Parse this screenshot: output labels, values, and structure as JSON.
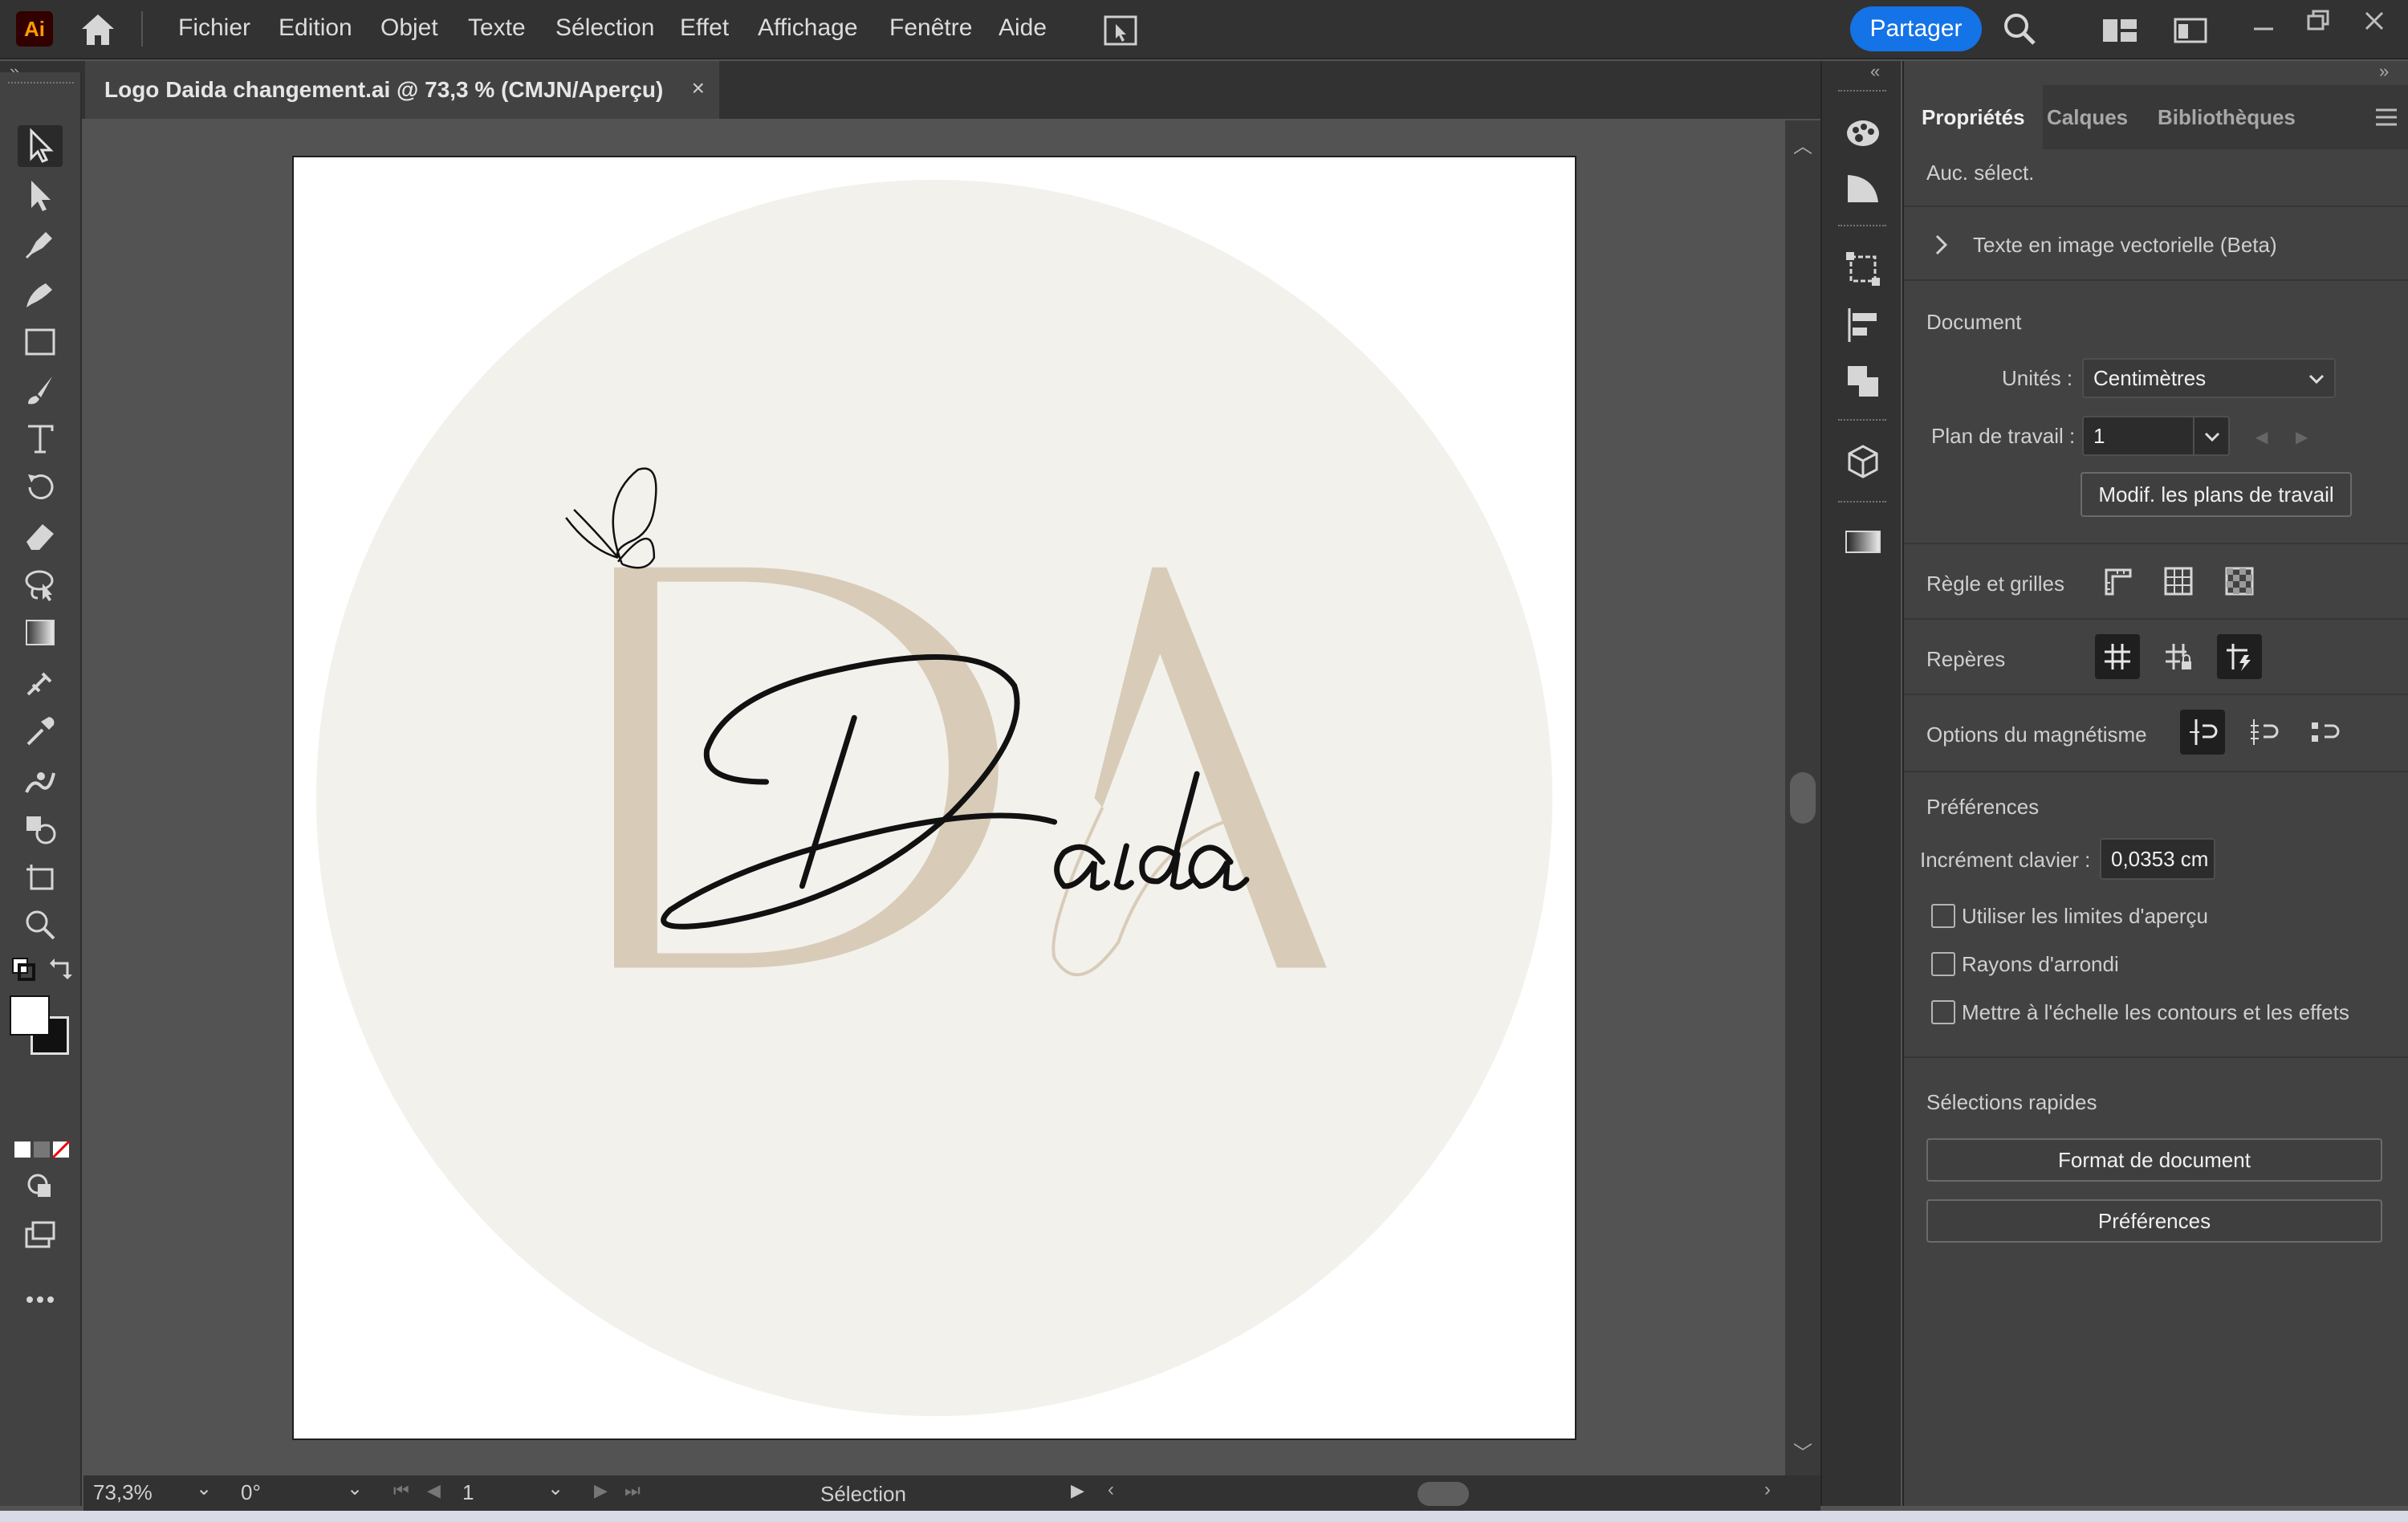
{
  "app": {
    "logo_text": "Ai"
  },
  "menubar": {
    "items": [
      "Fichier",
      "Edition",
      "Objet",
      "Texte",
      "Sélection",
      "Effet",
      "Affichage",
      "Fenêtre",
      "Aide"
    ],
    "share_label": "Partager"
  },
  "document_tab": {
    "title": "Logo Daida changement.ai @ 73,3 % (CMJN/Aperçu)",
    "close": "×"
  },
  "status": {
    "zoom": "73,3%",
    "rotation": "0°",
    "artboard_number": "1",
    "tool_name": "Sélection"
  },
  "artwork": {
    "monogram": "DA",
    "script_text": "Daida",
    "colors": {
      "circle": "#f3f1ec",
      "monogram": "#d8ccb8",
      "script": "#111111"
    }
  },
  "panel": {
    "tabs": [
      "Propriétés",
      "Calques",
      "Bibliothèques"
    ],
    "no_selection": "Auc. sélect.",
    "vector_text_section": "Texte en image vectorielle (Beta)",
    "document_heading": "Document",
    "units_label": "Unités :",
    "units_value": "Centimètres",
    "artboard_label": "Plan de travail :",
    "artboard_value": "1",
    "edit_artboards_button": "Modif. les plans de travail",
    "rulers_label": "Règle et grilles",
    "guides_label": "Repères",
    "snap_label": "Options du magnétisme",
    "preferences_heading": "Préférences",
    "keyboard_increment_label": "Incrément clavier :",
    "keyboard_increment_value": "0,0353 cm",
    "checkboxes": [
      "Utiliser les limites d'aperçu",
      "Rayons d'arrondi",
      "Mettre à l'échelle les contours et les effets"
    ],
    "quick_actions_heading": "Sélections rapides",
    "quick_buttons": [
      "Format de document",
      "Préférences"
    ]
  },
  "accent_color": "#1473e6"
}
